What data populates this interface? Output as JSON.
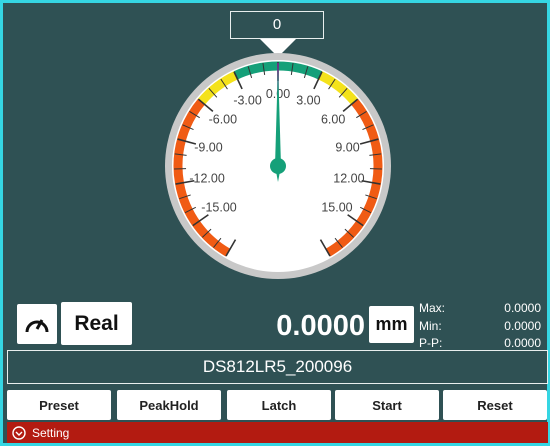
{
  "indicator_value": "0",
  "gauge": {
    "min": -18,
    "max": 18,
    "value": 0,
    "labels": [
      "-15.00",
      "-12.00",
      "-9.00",
      "-6.00",
      "-3.00",
      "0.00",
      "3.00",
      "6.00",
      "9.00",
      "12.00",
      "15.00"
    ],
    "label_values": [
      -15,
      -12,
      -9,
      -6,
      -3,
      0,
      3,
      6,
      9,
      12,
      15
    ],
    "zones": [
      {
        "from": -3,
        "to": 3,
        "color": "#15a079"
      },
      {
        "from": -6,
        "to": -3,
        "color": "#f4e21b"
      },
      {
        "from": 3,
        "to": 6,
        "color": "#f4e21b"
      },
      {
        "from": -18,
        "to": -6,
        "color": "#f05b14"
      },
      {
        "from": 6,
        "to": 18,
        "color": "#f05b14"
      }
    ],
    "needle_color": "#15a079"
  },
  "controls": {
    "gauge_icon": "speedometer-icon",
    "mode_label": "Real",
    "reading": "0.0000",
    "unit": "mm"
  },
  "stats": [
    {
      "label": "Max:",
      "value": "0.0000"
    },
    {
      "label": "Min:",
      "value": "0.0000"
    },
    {
      "label": "P-P:",
      "value": "0.0000"
    }
  ],
  "device_name": "DS812LR5_200096",
  "buttons": [
    "Preset",
    "PeakHold",
    "Latch",
    "Start",
    "Reset"
  ],
  "setting": {
    "icon": "chevron-down-circle-icon",
    "label": "Setting"
  }
}
